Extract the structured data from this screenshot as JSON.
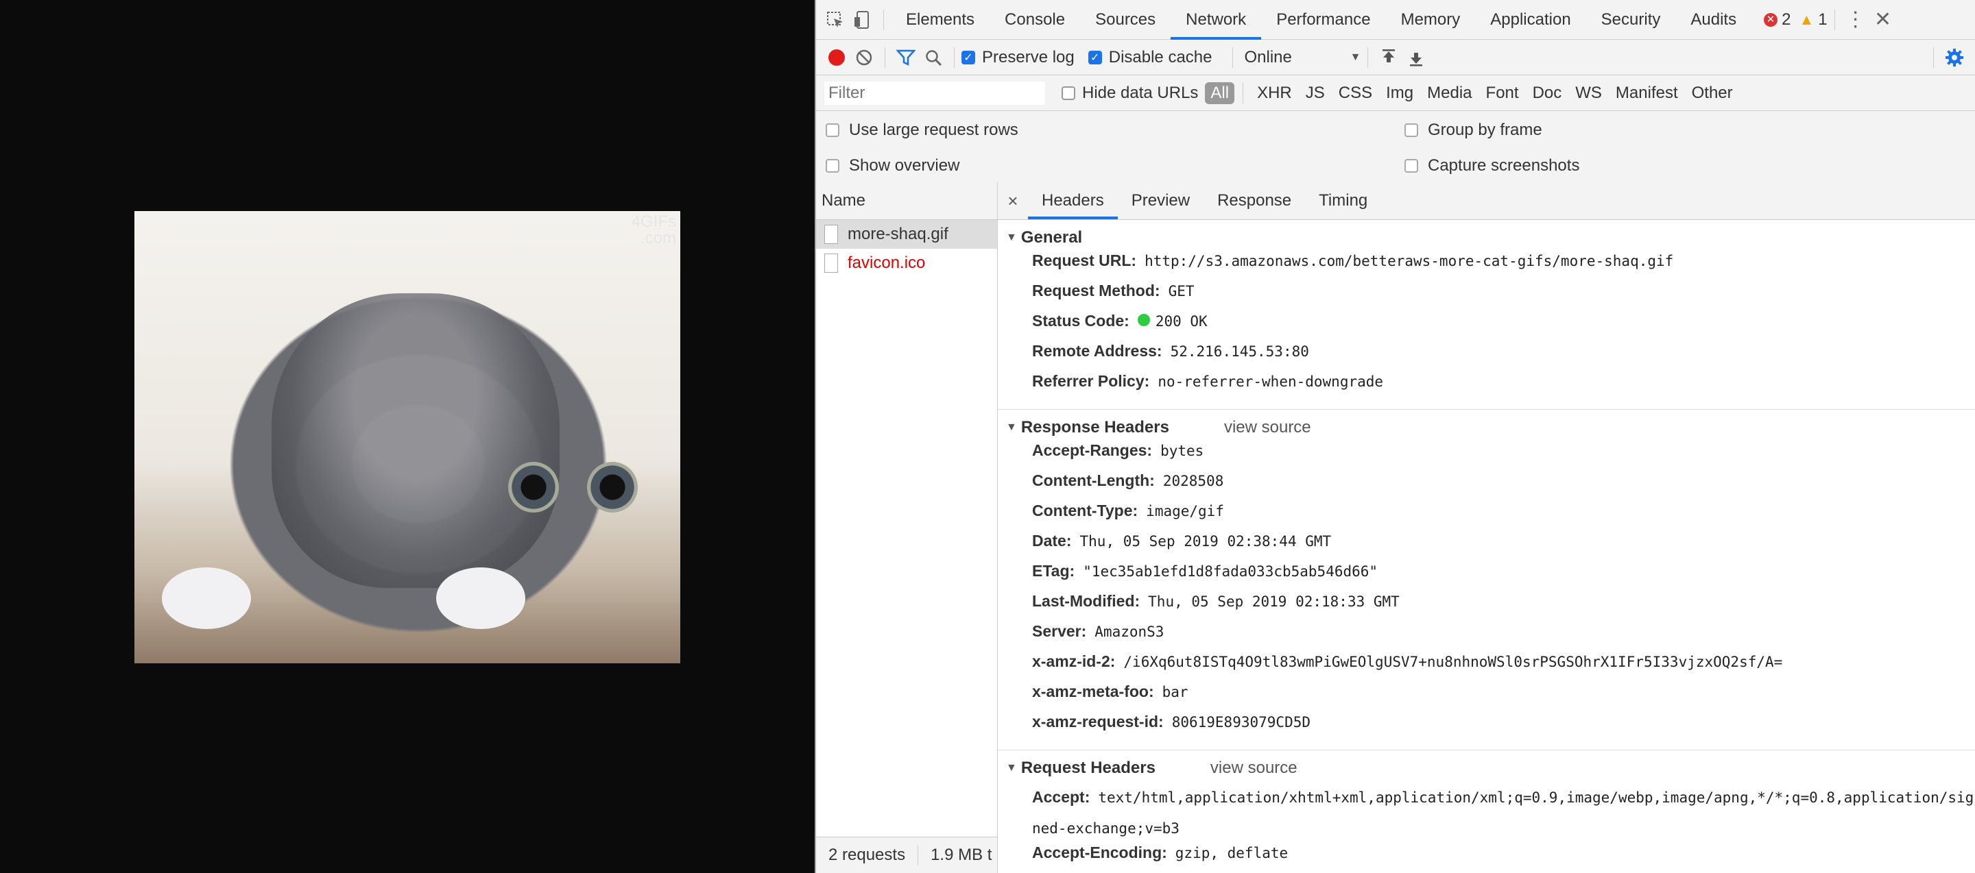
{
  "viewport": {
    "watermark_line1": "4GIFs",
    "watermark_line2": ".com"
  },
  "devtools": {
    "tabs": [
      "Elements",
      "Console",
      "Sources",
      "Network",
      "Performance",
      "Memory",
      "Application",
      "Security",
      "Audits"
    ],
    "active_tab": "Network",
    "error_count": "2",
    "warning_count": "1",
    "toolbar": {
      "preserve_log": "Preserve log",
      "disable_cache": "Disable cache",
      "throttle": "Online"
    },
    "filter": {
      "placeholder": "Filter",
      "hide_data_urls": "Hide data URLs",
      "types": [
        "All",
        "XHR",
        "JS",
        "CSS",
        "Img",
        "Media",
        "Font",
        "Doc",
        "WS",
        "Manifest",
        "Other"
      ]
    },
    "options": {
      "large_rows": "Use large request rows",
      "show_overview": "Show overview",
      "group_by_frame": "Group by frame",
      "capture_screenshots": "Capture screenshots"
    },
    "requests": {
      "header": "Name",
      "items": [
        "more-shaq.gif",
        "favicon.ico"
      ],
      "footer_count": "2 requests",
      "footer_size": "1.9 MB t"
    },
    "detail": {
      "tabs": [
        "Headers",
        "Preview",
        "Response",
        "Timing"
      ],
      "close": "×",
      "general": {
        "title": "General",
        "rows": [
          {
            "k": "Request URL:",
            "v": "http://s3.amazonaws.com/betteraws-more-cat-gifs/more-shaq.gif"
          },
          {
            "k": "Request Method:",
            "v": "GET"
          },
          {
            "k": "Status Code:",
            "v": "200 OK"
          },
          {
            "k": "Remote Address:",
            "v": "52.216.145.53:80"
          },
          {
            "k": "Referrer Policy:",
            "v": "no-referrer-when-downgrade"
          }
        ]
      },
      "response_headers": {
        "title": "Response Headers",
        "view_source": "view source",
        "rows": [
          {
            "k": "Accept-Ranges:",
            "v": "bytes"
          },
          {
            "k": "Content-Length:",
            "v": "2028508"
          },
          {
            "k": "Content-Type:",
            "v": "image/gif"
          },
          {
            "k": "Date:",
            "v": "Thu, 05 Sep 2019 02:38:44 GMT"
          },
          {
            "k": "ETag:",
            "v": "\"1ec35ab1efd1d8fada033cb5ab546d66\""
          },
          {
            "k": "Last-Modified:",
            "v": "Thu, 05 Sep 2019 02:18:33 GMT"
          },
          {
            "k": "Server:",
            "v": "AmazonS3"
          },
          {
            "k": "x-amz-id-2:",
            "v": "/i6Xq6ut8ISTq4O9tl83wmPiGwEOlgUSV7+nu8nhnoWSl0srPSGSOhrX1IFr5I33vjzxOQ2sf/A="
          },
          {
            "k": "x-amz-meta-foo:",
            "v": "bar"
          },
          {
            "k": "x-amz-request-id:",
            "v": "80619E893079CD5D"
          }
        ]
      },
      "request_headers": {
        "title": "Request Headers",
        "view_source": "view source",
        "accept_key": "Accept:",
        "accept_value": "text/html,application/xhtml+xml,application/xml;q=0.9,image/webp,image/apng,*/*;q=0.8,application/signed-exchange;v=b3",
        "next_key": "Accept-Encoding:",
        "next_value": "gzip, deflate"
      }
    }
  }
}
